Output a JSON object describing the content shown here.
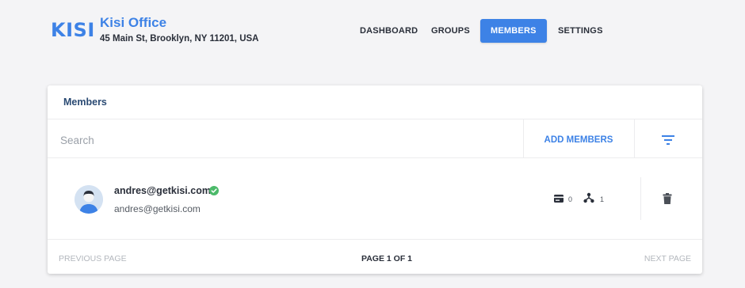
{
  "brand": {
    "logo_text": "KISI",
    "accent_color": "#3d82e6"
  },
  "place": {
    "name": "Kisi Office",
    "address": "45 Main St, Brooklyn, NY 11201, USA"
  },
  "nav": {
    "items": [
      {
        "label": "DASHBOARD",
        "active": false
      },
      {
        "label": "GROUPS",
        "active": false
      },
      {
        "label": "MEMBERS",
        "active": true
      },
      {
        "label": "SETTINGS",
        "active": false
      }
    ]
  },
  "members_panel": {
    "title": "Members",
    "search": {
      "placeholder": "Search",
      "value": ""
    },
    "add_members_label": "ADD MEMBERS",
    "filter_icon": "filter-icon",
    "rows": [
      {
        "name": "andres@getkisi.com",
        "email": "andres@getkisi.com",
        "verified": true,
        "verified_color": "#4cba6a",
        "cards_count": "0",
        "groups_count": "1",
        "icons": [
          "avatar",
          "check-circle-icon",
          "card-icon",
          "hierarchy-icon",
          "trash-icon"
        ]
      }
    ],
    "pagination": {
      "prev_label": "PREVIOUS PAGE",
      "page_info": "PAGE 1 OF 1",
      "next_label": "NEXT PAGE"
    }
  }
}
